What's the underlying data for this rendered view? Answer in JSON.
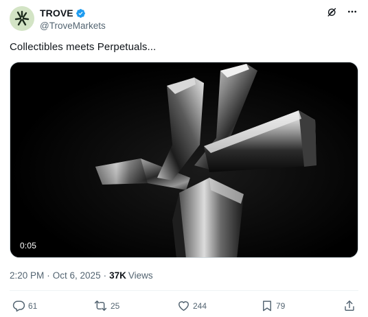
{
  "post": {
    "display_name": "TROVE",
    "handle": "@TroveMarkets",
    "verified_icon": "verified-badge-icon",
    "text": "Collectibles meets Perpetuals...",
    "media": {
      "type": "video",
      "duration": "0:05"
    },
    "meta": {
      "time": "2:20 PM",
      "dot1": "·",
      "date": "Oct 6, 2025",
      "dot2": "·",
      "views_count": "37K",
      "views_label": "Views"
    },
    "actions": {
      "reply_count": "61",
      "repost_count": "25",
      "like_count": "244",
      "bookmark_count": "79"
    }
  },
  "colors": {
    "text_primary": "#0f1419",
    "text_secondary": "#536471",
    "verified_blue": "#1d9bf0",
    "media_background": "#000000"
  },
  "icons": {
    "grok": "grok-icon",
    "more": "more-icon",
    "reply": "reply-icon",
    "repost": "repost-icon",
    "like": "like-icon",
    "bookmark": "bookmark-icon",
    "share": "share-icon"
  }
}
